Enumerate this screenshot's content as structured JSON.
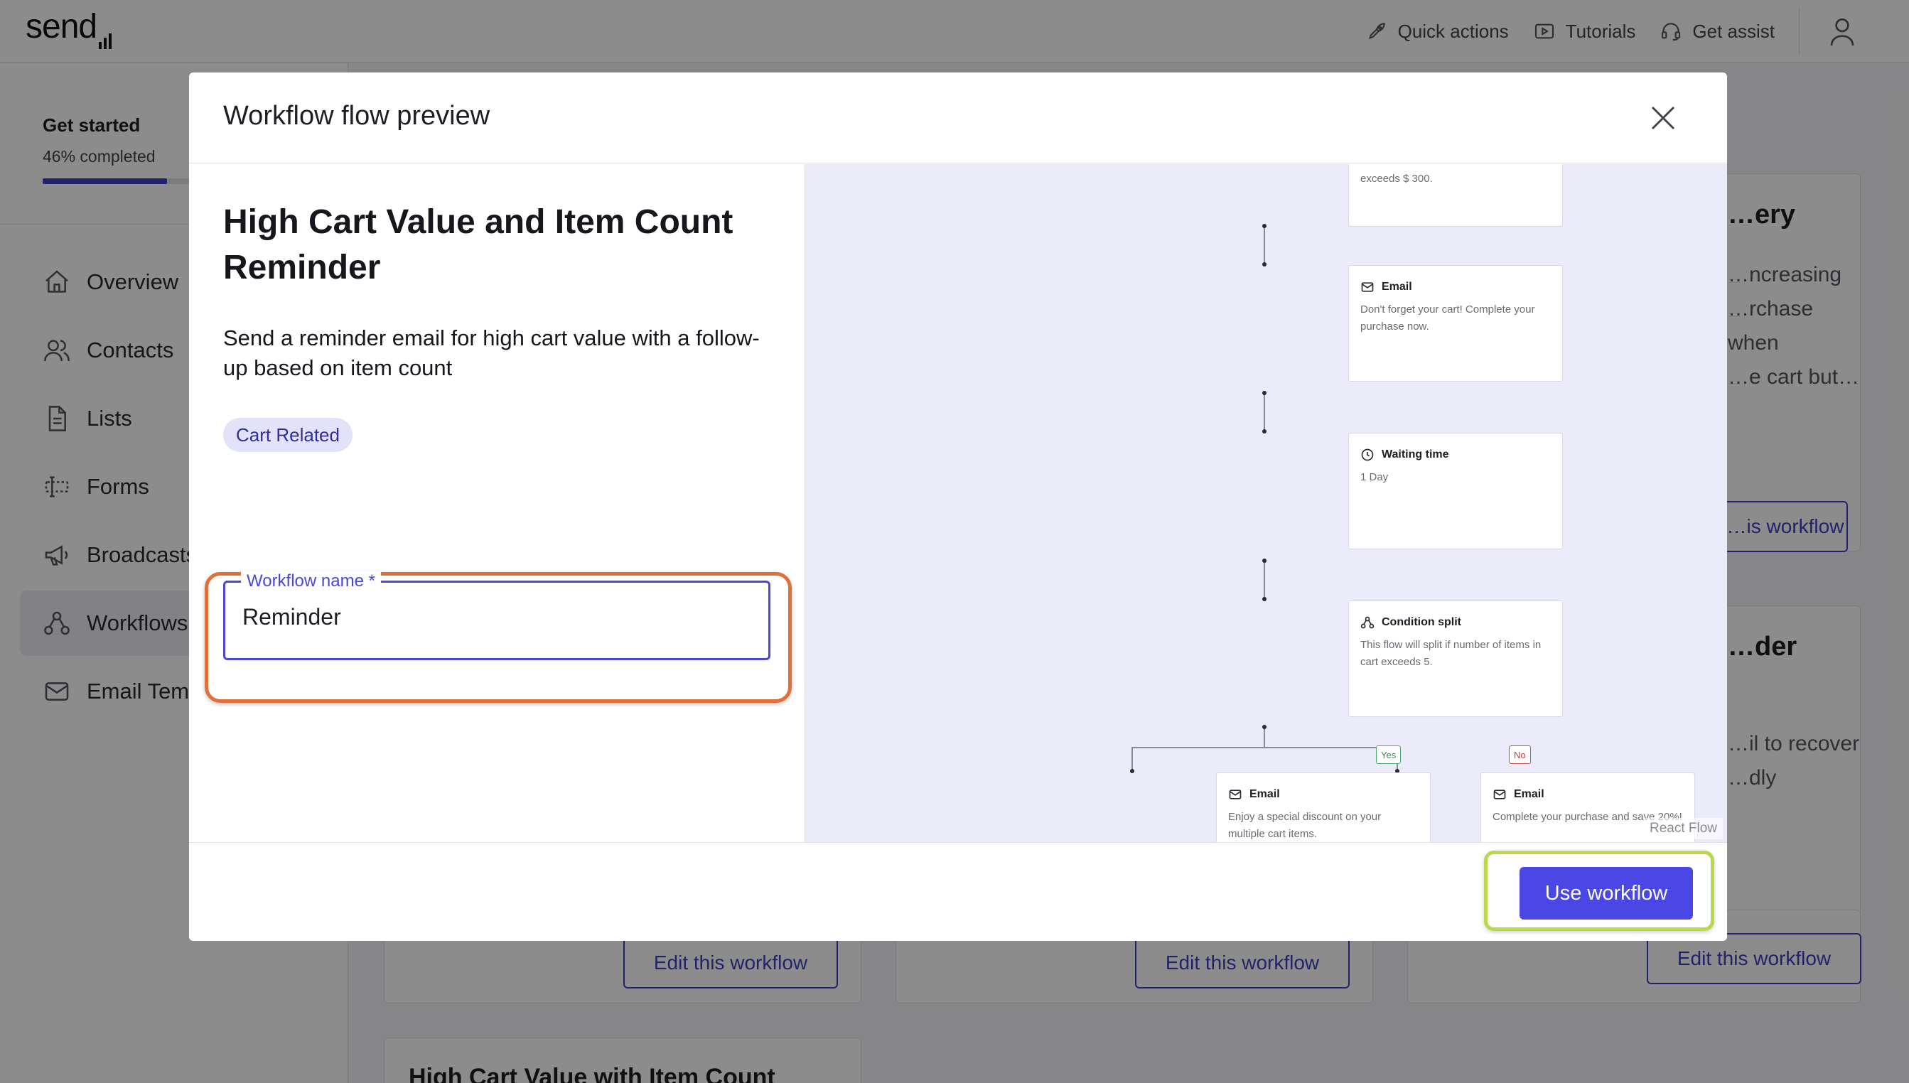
{
  "app": {
    "logo": "send"
  },
  "topbar": {
    "quick_actions": "Quick actions",
    "tutorials": "Tutorials",
    "get_assist": "Get assist"
  },
  "sidebar": {
    "get_started_title": "Get started",
    "get_started_progress_text": "46% completed",
    "get_started_progress": 0.46,
    "items": [
      {
        "label": "Overview",
        "icon": "home-icon"
      },
      {
        "label": "Contacts",
        "icon": "users-icon"
      },
      {
        "label": "Lists",
        "icon": "document-icon"
      },
      {
        "label": "Forms",
        "icon": "form-icon"
      },
      {
        "label": "Broadcasts",
        "icon": "megaphone-icon"
      },
      {
        "label": "Workflows",
        "icon": "workflow-icon",
        "active": true
      },
      {
        "label": "Email Templates",
        "icon": "mail-icon"
      }
    ]
  },
  "background_cards": {
    "right_top": {
      "title": "…ery",
      "desc_lines": [
        "…ncreasing",
        "…rchase when",
        "…e cart but…"
      ],
      "button": "…is workflow"
    },
    "right_middle": {
      "title": "…der",
      "desc_lines": [
        "…il to recover",
        "…dly"
      ]
    },
    "bottom_buttons": [
      "Edit this workflow",
      "Edit this workflow",
      "Edit this workflow"
    ],
    "bottom_card_title": "High Cart Value with Item Count"
  },
  "modal": {
    "title": "Workflow flow preview",
    "workflow_title": "High Cart Value and Item Count Reminder",
    "workflow_description": "Send a reminder email for high cart value with a follow-up based on item count",
    "tag": "Cart Related",
    "name_field": {
      "label": "Workflow name *",
      "value": "Reminder"
    },
    "use_button": "Use workflow",
    "react_flow_attribution": "React Flow"
  },
  "flow": {
    "nodes": [
      {
        "type": "trigger",
        "title": "",
        "desc": "exceeds $ 300.",
        "icon": ""
      },
      {
        "type": "email",
        "title": "Email",
        "desc": "Don't forget your cart! Complete your purchase now.",
        "icon": "mail-icon"
      },
      {
        "type": "wait",
        "title": "Waiting time",
        "desc": "1 Day",
        "icon": "clock-icon"
      },
      {
        "type": "condition",
        "title": "Condition split",
        "desc": "This flow will split if number of items in cart exceeds 5.",
        "icon": "split-icon"
      },
      {
        "type": "email",
        "title": "Email",
        "desc": "Enjoy a special discount on your multiple cart items.",
        "icon": "mail-icon"
      },
      {
        "type": "email",
        "title": "Email",
        "desc": "Complete your purchase and save 20%!",
        "icon": "mail-icon"
      }
    ],
    "branch_yes": "Yes",
    "branch_no": "No"
  },
  "colors": {
    "primary": "#4a47e4",
    "highlight_field": "#e0703a",
    "highlight_button": "#b8d94a",
    "flow_background": "#ebebfa"
  }
}
